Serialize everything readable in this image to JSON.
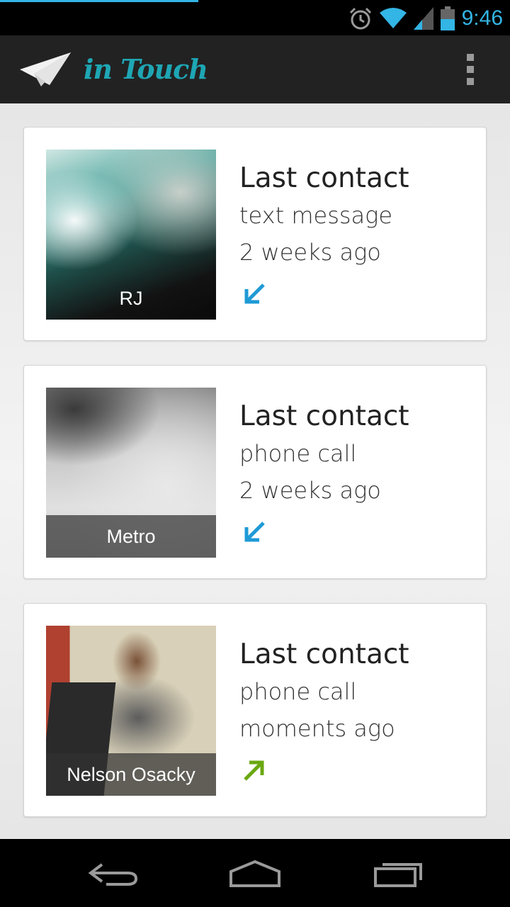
{
  "status_bar": {
    "time": "9:46",
    "icons": [
      "alarm-icon",
      "wifi-icon",
      "cell-signal-icon",
      "battery-icon"
    ],
    "accent_color": "#33b5e5"
  },
  "action_bar": {
    "title": "in Touch",
    "logo_icon": "paper-plane-icon",
    "overflow_icon": "overflow-menu-icon",
    "title_color": "#1ea6b4"
  },
  "contacts": [
    {
      "name": "RJ",
      "heading": "Last contact",
      "method": "text message",
      "when": "2 weeks ago",
      "direction": "incoming",
      "direction_icon": "arrow-incoming-icon",
      "direction_color": "#1e9ad6"
    },
    {
      "name": "Metro",
      "heading": "Last contact",
      "method": "phone call",
      "when": "2 weeks ago",
      "direction": "incoming",
      "direction_icon": "arrow-incoming-icon",
      "direction_color": "#1e9ad6"
    },
    {
      "name": "Nelson Osacky",
      "heading": "Last contact",
      "method": "phone call",
      "when": "moments ago",
      "direction": "outgoing",
      "direction_icon": "arrow-outgoing-icon",
      "direction_color": "#6aa812"
    }
  ],
  "nav_bar": {
    "buttons": [
      "back-icon",
      "home-icon",
      "recent-apps-icon"
    ]
  }
}
